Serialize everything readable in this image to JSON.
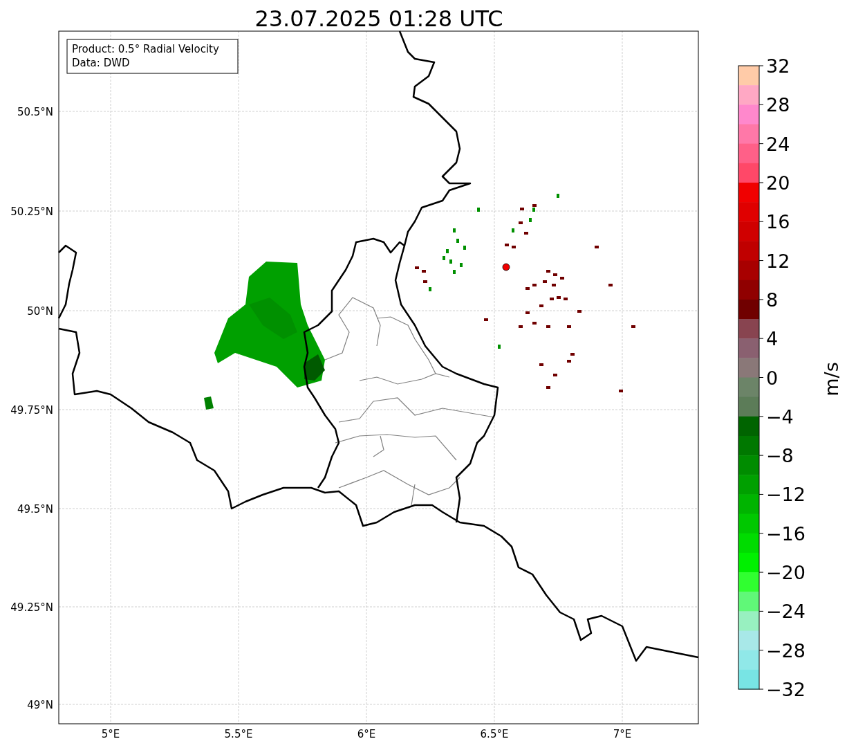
{
  "title": "23.07.2025 01:28 UTC",
  "info_box": {
    "lines": [
      "Product: 0.5° Radial Velocity",
      "Data: DWD"
    ]
  },
  "map": {
    "lat_labels": [
      "50.5°N",
      "50.25°N",
      "50°N",
      "49.75°N",
      "49.5°N",
      "49.25°N",
      "49°N"
    ],
    "lon_labels": [
      "5°E",
      "5.5°E",
      "6°E",
      "6.5°E",
      "7°E"
    ]
  },
  "colorbar": {
    "label": "m/s",
    "ticks": [
      "32",
      "28",
      "24",
      "20",
      "16",
      "12",
      "8",
      "4",
      "0",
      "−4",
      "−8",
      "−12",
      "−16",
      "−20",
      "−24",
      "−28",
      "−32"
    ],
    "segments": [
      {
        "color": "#ffcba8"
      },
      {
        "color": "#ffa8c4"
      },
      {
        "color": "#ff88cc"
      },
      {
        "color": "#ff78a8"
      },
      {
        "color": "#ff6088"
      },
      {
        "color": "#ff4868"
      },
      {
        "color": "#f00000"
      },
      {
        "color": "#e00000"
      },
      {
        "color": "#d00000"
      },
      {
        "color": "#c00000"
      },
      {
        "color": "#a80000"
      },
      {
        "color": "#900000"
      },
      {
        "color": "#700000"
      },
      {
        "color": "#884450"
      },
      {
        "color": "#8a6070"
      },
      {
        "color": "#8a7878"
      },
      {
        "color": "#6c8468"
      },
      {
        "color": "#5c7c58"
      },
      {
        "color": "#006400"
      },
      {
        "color": "#007800"
      },
      {
        "color": "#008c00"
      },
      {
        "color": "#00a000"
      },
      {
        "color": "#00b400"
      },
      {
        "color": "#00c800"
      },
      {
        "color": "#00dc00"
      },
      {
        "color": "#00f000"
      },
      {
        "color": "#30ff30"
      },
      {
        "color": "#60f878"
      },
      {
        "color": "#98f0c0"
      },
      {
        "color": "#a8e8e8"
      },
      {
        "color": "#90e8e8"
      },
      {
        "color": "#78e4e4"
      }
    ]
  }
}
